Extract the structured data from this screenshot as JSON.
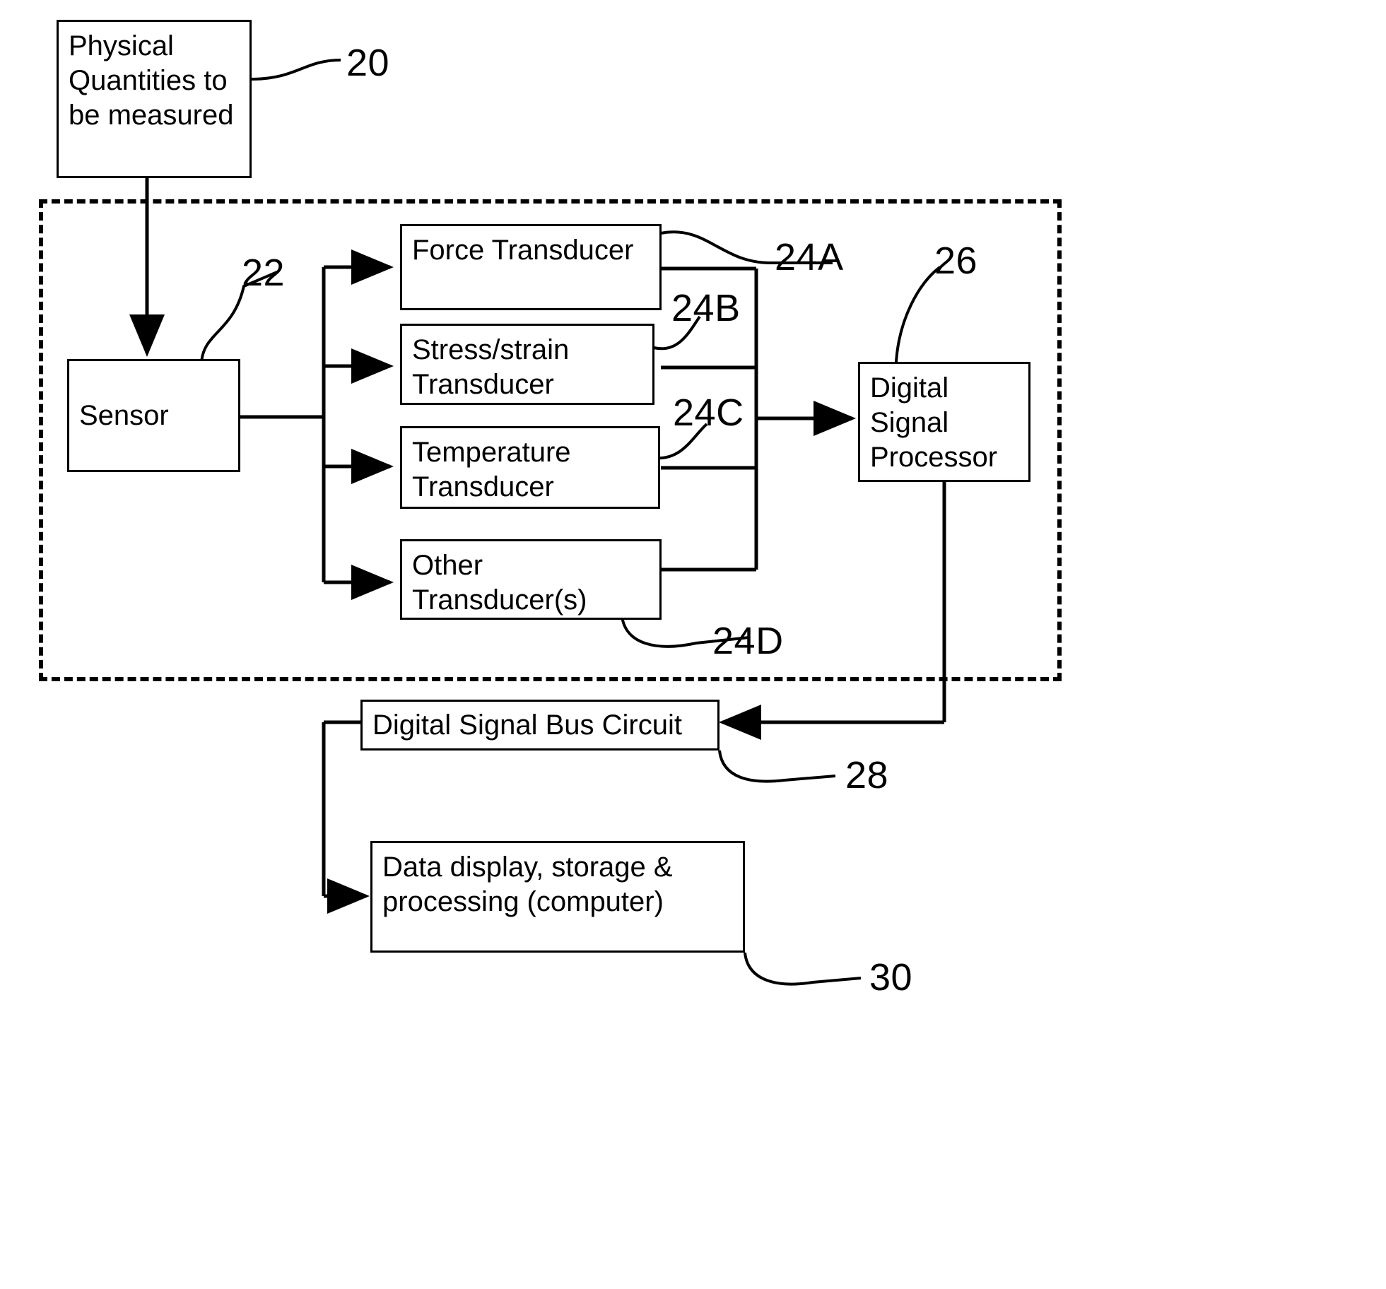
{
  "figure": {
    "type": "patent-block-diagram",
    "blocks": [
      {
        "id": "physical-quantities",
        "label": "Physical\nQuantities to\nbe measured",
        "ref": "20"
      },
      {
        "id": "sensor",
        "label": "Sensor",
        "ref": "22"
      },
      {
        "id": "force-transducer",
        "label": "Force Transducer",
        "ref": "24A"
      },
      {
        "id": "stress-strain-transducer",
        "label": "Stress/strain\nTransducer",
        "ref": "24B"
      },
      {
        "id": "temperature-transducer",
        "label": "Temperature\nTransducer",
        "ref": "24C"
      },
      {
        "id": "other-transducers",
        "label": "Other\nTransducer(s)",
        "ref": "24D"
      },
      {
        "id": "digital-signal-processor",
        "label": "Digital\nSignal\nProcessor",
        "ref": "26"
      },
      {
        "id": "digital-signal-bus-circuit",
        "label": "Digital Signal Bus Circuit",
        "ref": "28"
      },
      {
        "id": "data-display",
        "label": "Data display, storage &\nprocessing (computer)",
        "ref": "30"
      }
    ],
    "reference_numerals": {
      "physical_quantities": "20",
      "sensor": "22",
      "force_transducer": "24A",
      "stress_strain_transducer": "24B",
      "temperature_transducer": "24C",
      "other_transducers": "24D",
      "digital_signal_processor": "26",
      "digital_signal_bus_circuit": "28",
      "data_display": "30"
    },
    "colors": {
      "line": "#000000",
      "background": "#ffffff",
      "text": "#000000"
    }
  }
}
